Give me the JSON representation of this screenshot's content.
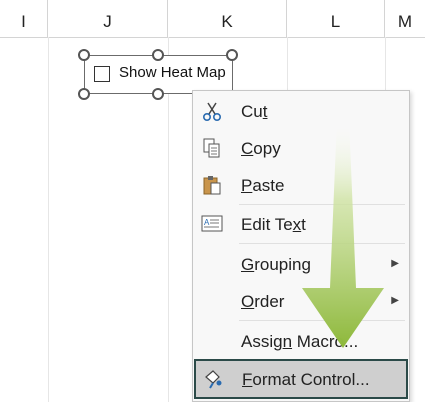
{
  "columns": [
    "I",
    "J",
    "K",
    "L",
    "M"
  ],
  "control": {
    "label": "Show Heat Map",
    "checked": false
  },
  "menu": {
    "items": [
      {
        "label_pre": "Cu",
        "label_u": "t",
        "label_post": "",
        "icon": "scissors-icon"
      },
      {
        "label_pre": "",
        "label_u": "C",
        "label_post": "opy",
        "icon": "copy-icon"
      },
      {
        "label_pre": "",
        "label_u": "P",
        "label_post": "aste",
        "icon": "paste-icon"
      },
      {
        "label_pre": "Edit Te",
        "label_u": "x",
        "label_post": "t",
        "icon": "edit-text-icon"
      },
      {
        "label_pre": "",
        "label_u": "G",
        "label_post": "rouping",
        "submenu": true
      },
      {
        "label_pre": "",
        "label_u": "O",
        "label_post": "rder",
        "submenu": true
      },
      {
        "label_pre": "Assig",
        "label_u": "n",
        "label_post": " Macro...",
        "icon": null
      },
      {
        "label_pre": "",
        "label_u": "F",
        "label_post": "ormat Control...",
        "icon": "format-control-icon"
      }
    ],
    "submenu_arrow": "▶"
  },
  "colors": {
    "highlight_border": "#2b4a48",
    "highlight_bg": "#cfcfcf",
    "arrow_green": "#8db83a"
  }
}
